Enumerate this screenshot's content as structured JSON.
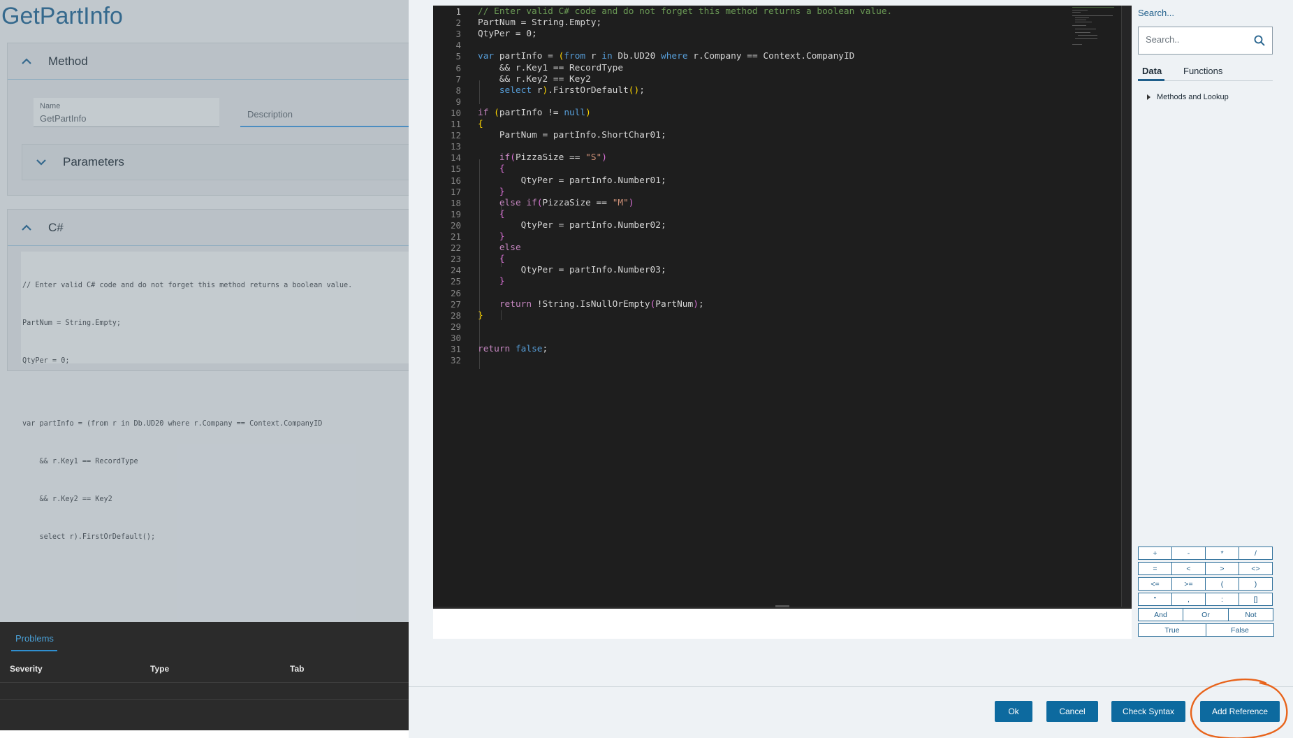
{
  "left": {
    "page_title": "GetPartInfo",
    "method_panel": {
      "title": "Method",
      "name_label": "Name",
      "name_value": "GetPartInfo",
      "description_label": "Description",
      "parameters_title": "Parameters"
    },
    "csharp_panel": {
      "title": "C#",
      "preview_lines": [
        "// Enter valid C# code and do not forget this method returns a boolean value.",
        "PartNum = String.Empty;",
        "QtyPer = 0;",
        "",
        "var partInfo = (from r in Db.UD20 where r.Company == Context.CompanyID",
        "    && r.Key1 == RecordType",
        "    && r.Key2 == Key2",
        "    select r).FirstOrDefault();"
      ]
    },
    "problems": {
      "tab": "Problems",
      "columns": [
        "Severity",
        "Type",
        "Tab"
      ]
    }
  },
  "editor": {
    "line_numbers": [
      "1",
      "2",
      "3",
      "4",
      "5",
      "6",
      "7",
      "8",
      "9",
      "10",
      "11",
      "12",
      "13",
      "14",
      "15",
      "16",
      "17",
      "18",
      "19",
      "20",
      "21",
      "22",
      "23",
      "24",
      "25",
      "26",
      "27",
      "28",
      "29",
      "30",
      "31",
      "32"
    ],
    "active_line": 1,
    "colors": {
      "comment": "#6a9955",
      "keyword": "#569cd6",
      "control": "#c586c0",
      "string": "#ce9178",
      "text": "#d4d4d4",
      "brace1": "#ffd700",
      "brace2": "#da70d6"
    }
  },
  "side": {
    "search_title": "Search...",
    "search_placeholder": "Search..",
    "tabs": [
      "Data",
      "Functions"
    ],
    "active_tab": "Data",
    "tree_item": "Methods and Lookup",
    "operators": [
      [
        "+",
        "-",
        "*",
        "/"
      ],
      [
        "=",
        "<",
        ">",
        "<>"
      ],
      [
        "<=",
        ">=",
        "(",
        ")"
      ],
      [
        "\"",
        ",",
        ":",
        "[]"
      ],
      [
        "And",
        "Or",
        "Not"
      ],
      [
        "True",
        "False"
      ]
    ]
  },
  "buttons": {
    "ok": "Ok",
    "cancel": "Cancel",
    "check_syntax": "Check Syntax",
    "add_reference": "Add Reference"
  },
  "annotation_color": "#e8631a"
}
